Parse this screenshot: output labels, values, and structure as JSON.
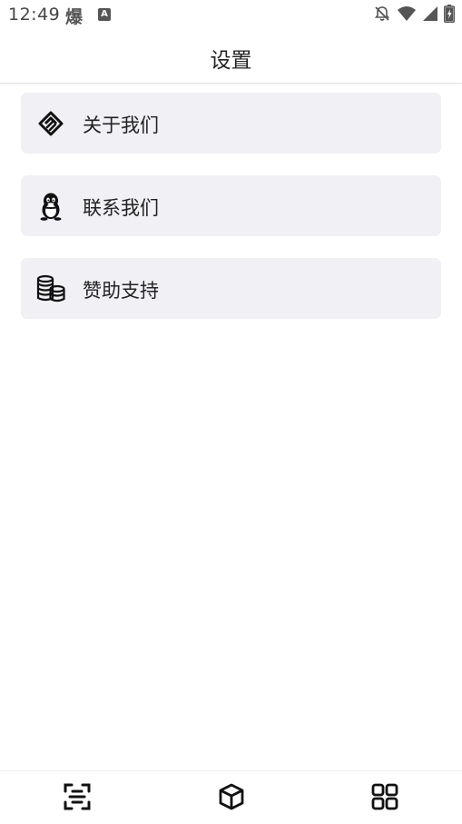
{
  "status_bar": {
    "time": "12:49",
    "app_glyph": "爆",
    "badge_letter": "A",
    "icons": [
      "notifications-off-icon",
      "wifi-icon",
      "signal-icon",
      "battery-charging-icon"
    ]
  },
  "header": {
    "title": "设置"
  },
  "menu": {
    "items": [
      {
        "label": "关于我们",
        "icon": "handshake-icon"
      },
      {
        "label": "联系我们",
        "icon": "qq-penguin-icon"
      },
      {
        "label": "赞助支持",
        "icon": "coins-icon"
      }
    ]
  },
  "bottom_nav": {
    "items": [
      {
        "icon": "scan-icon"
      },
      {
        "icon": "cube-icon"
      },
      {
        "icon": "grid-icon"
      }
    ]
  },
  "colors": {
    "card_background": "#f0f0f5",
    "text": "#222222",
    "background": "#ffffff"
  }
}
